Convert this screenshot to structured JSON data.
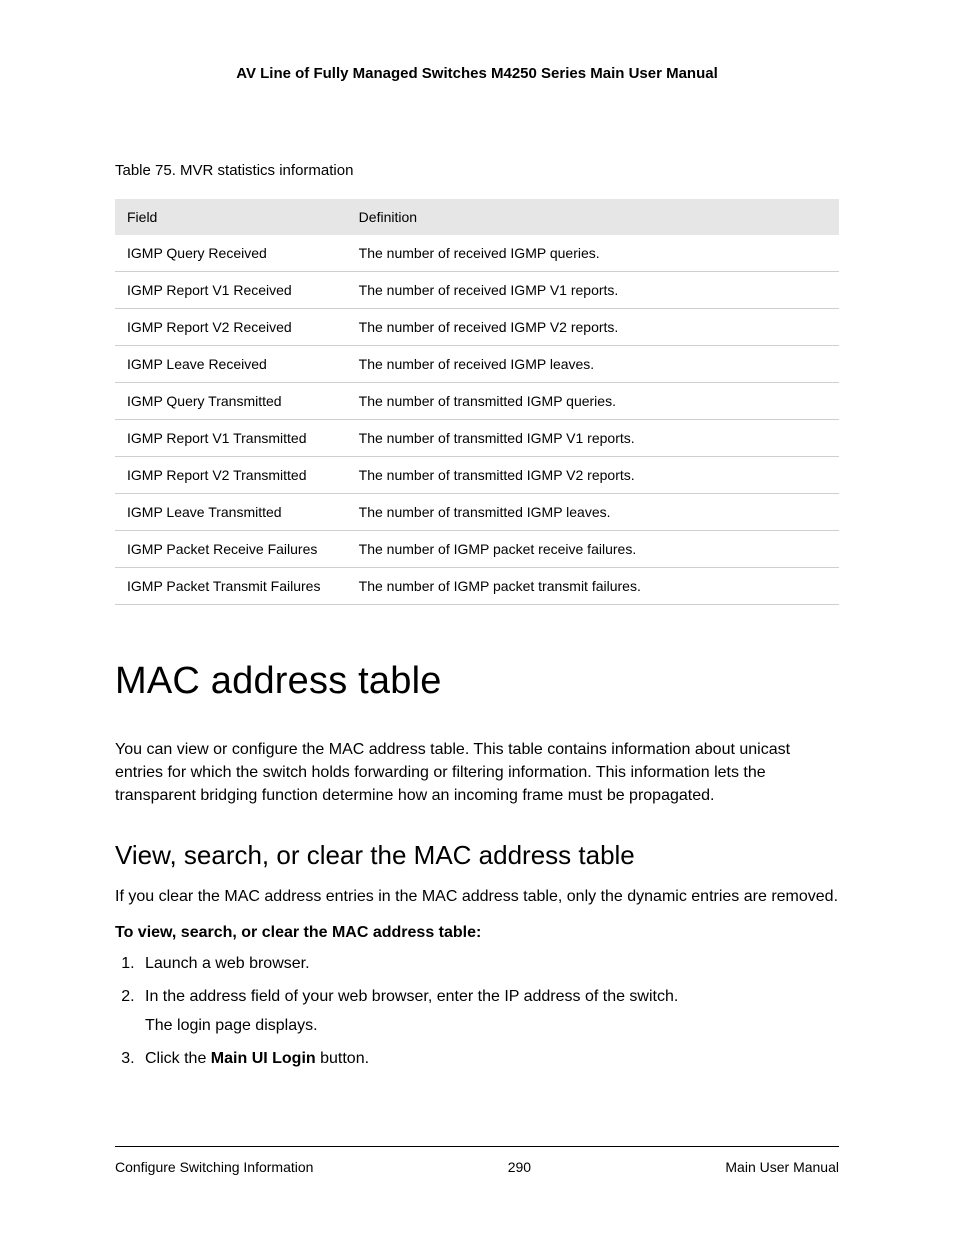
{
  "header": {
    "title": "AV Line of Fully Managed Switches M4250 Series Main User Manual"
  },
  "table": {
    "caption": "Table 75. MVR statistics information",
    "columns": [
      "Field",
      "Definition"
    ],
    "rows": [
      {
        "field": "IGMP Query Received",
        "definition": "The number of received IGMP queries."
      },
      {
        "field": "IGMP Report V1 Received",
        "definition": "The number of received IGMP V1 reports."
      },
      {
        "field": "IGMP Report V2 Received",
        "definition": "The number of received IGMP V2 reports."
      },
      {
        "field": "IGMP Leave Received",
        "definition": "The number of received IGMP leaves."
      },
      {
        "field": "IGMP Query Transmitted",
        "definition": "The number of transmitted IGMP queries."
      },
      {
        "field": "IGMP Report V1 Transmitted",
        "definition": "The number of transmitted IGMP V1 reports."
      },
      {
        "field": "IGMP Report V2 Transmitted",
        "definition": "The number of transmitted IGMP V2 reports."
      },
      {
        "field": "IGMP Leave Transmitted",
        "definition": "The number of transmitted IGMP leaves."
      },
      {
        "field": "IGMP Packet Receive Failures",
        "definition": "The number of IGMP packet receive failures."
      },
      {
        "field": "IGMP Packet Transmit Failures",
        "definition": "The number of IGMP packet transmit failures."
      }
    ]
  },
  "section": {
    "title": "MAC address table",
    "intro": "You can view or configure the MAC address table. This table contains information about unicast entries for which the switch holds forwarding or filtering information. This information lets the transparent bridging function determine how an incoming frame must be propagated."
  },
  "subsection": {
    "title": "View, search, or clear the MAC address table",
    "intro": "If you clear the MAC address entries in the MAC address table, only the dynamic entries are removed.",
    "procedure_title": "To view, search, or clear the MAC address table:",
    "steps": {
      "s1": "Launch a web browser.",
      "s2": "In the address field of your web browser, enter the IP address of the switch.",
      "s2_sub": "The login page displays.",
      "s3_pre": "Click the ",
      "s3_bold": "Main UI Login",
      "s3_post": " button."
    }
  },
  "footer": {
    "left": "Configure Switching Information",
    "center": "290",
    "right": "Main User Manual"
  }
}
